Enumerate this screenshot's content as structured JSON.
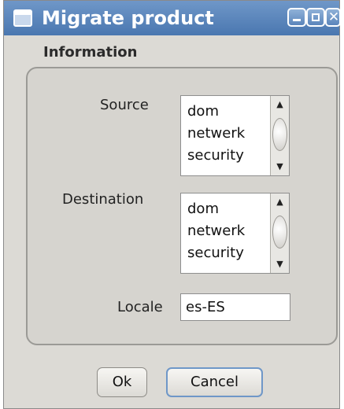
{
  "window": {
    "title": "Migrate product",
    "buttons": {
      "minimize": "minimize-icon",
      "maximize": "maximize-icon",
      "close": "close-icon"
    }
  },
  "form": {
    "group_title": "Information",
    "source": {
      "label": "Source",
      "options": [
        "dom",
        "netwerk",
        "security"
      ]
    },
    "destination": {
      "label": "Destination",
      "options": [
        "dom",
        "netwerk",
        "security"
      ]
    },
    "locale": {
      "label": "Locale",
      "value": "es-ES"
    }
  },
  "actions": {
    "ok_label": "Ok",
    "cancel_label": "Cancel"
  },
  "colors": {
    "titlebar": "#4a77b0",
    "window_bg": "#dcdad5",
    "focus_ring": "#6f97c8"
  }
}
